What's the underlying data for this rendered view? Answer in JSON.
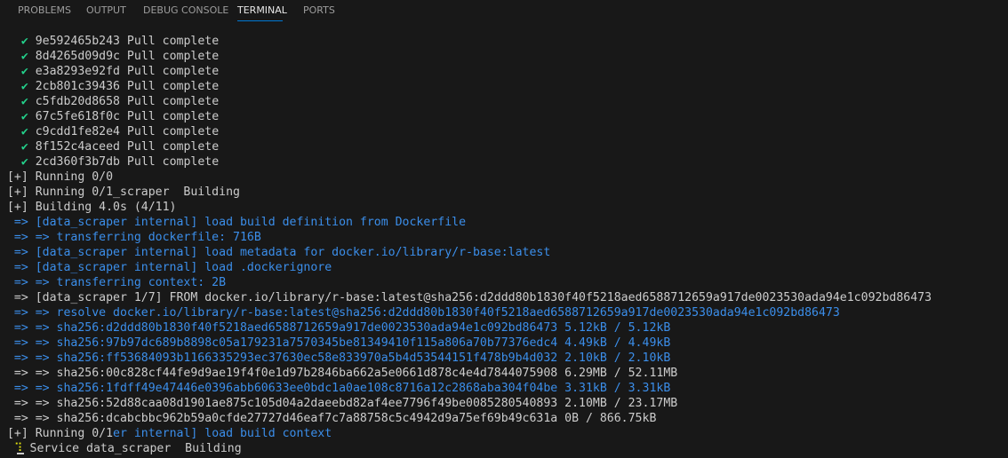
{
  "tabs": [
    {
      "label": "PROBLEMS",
      "active": false
    },
    {
      "label": "OUTPUT",
      "active": false
    },
    {
      "label": "DEBUG CONSOLE",
      "active": false
    },
    {
      "label": "TERMINAL",
      "active": true
    },
    {
      "label": "PORTS",
      "active": false
    }
  ],
  "colors": {
    "background": "#181818",
    "success": "#23d18b",
    "info": "#3b8eea",
    "text": "#cccccc",
    "accent": "#0078d4",
    "spinner": "#e5e510"
  },
  "terminal": {
    "lines": [
      {
        "name": "pull-line",
        "segments": [
          {
            "text": "   ",
            "style": "default"
          },
          {
            "text": "✔",
            "style": "ok",
            "icon": "check-icon"
          },
          {
            "text": " 9e592465b243 Pull complete",
            "style": "default"
          }
        ]
      },
      {
        "name": "pull-line",
        "segments": [
          {
            "text": "   ",
            "style": "default"
          },
          {
            "text": "✔",
            "style": "ok",
            "icon": "check-icon"
          },
          {
            "text": " 8d4265d09d9c Pull complete",
            "style": "default"
          }
        ]
      },
      {
        "name": "pull-line",
        "segments": [
          {
            "text": "   ",
            "style": "default"
          },
          {
            "text": "✔",
            "style": "ok",
            "icon": "check-icon"
          },
          {
            "text": " e3a8293e92fd Pull complete",
            "style": "default"
          }
        ]
      },
      {
        "name": "pull-line",
        "segments": [
          {
            "text": "   ",
            "style": "default"
          },
          {
            "text": "✔",
            "style": "ok",
            "icon": "check-icon"
          },
          {
            "text": " 2cb801c39436 Pull complete",
            "style": "default"
          }
        ]
      },
      {
        "name": "pull-line",
        "segments": [
          {
            "text": "   ",
            "style": "default"
          },
          {
            "text": "✔",
            "style": "ok",
            "icon": "check-icon"
          },
          {
            "text": " c5fdb20d8658 Pull complete",
            "style": "default"
          }
        ]
      },
      {
        "name": "pull-line",
        "segments": [
          {
            "text": "   ",
            "style": "default"
          },
          {
            "text": "✔",
            "style": "ok",
            "icon": "check-icon"
          },
          {
            "text": " 67c5fe618f0c Pull complete",
            "style": "default"
          }
        ]
      },
      {
        "name": "pull-line",
        "segments": [
          {
            "text": "   ",
            "style": "default"
          },
          {
            "text": "✔",
            "style": "ok",
            "icon": "check-icon"
          },
          {
            "text": " c9cdd1fe82e4 Pull complete",
            "style": "default"
          }
        ]
      },
      {
        "name": "pull-line",
        "segments": [
          {
            "text": "   ",
            "style": "default"
          },
          {
            "text": "✔",
            "style": "ok",
            "icon": "check-icon"
          },
          {
            "text": " 8f152c4aceed Pull complete",
            "style": "default"
          }
        ]
      },
      {
        "name": "pull-line",
        "segments": [
          {
            "text": "   ",
            "style": "default"
          },
          {
            "text": "✔",
            "style": "ok",
            "icon": "check-icon"
          },
          {
            "text": " 2cd360f3b7db Pull complete",
            "style": "default"
          }
        ]
      },
      {
        "name": "status-line",
        "segments": [
          {
            "text": " [+] Running 0/0",
            "style": "default"
          }
        ]
      },
      {
        "name": "status-line",
        "segments": [
          {
            "text": " [+] Running 0/1_scraper  Building",
            "style": "default"
          }
        ]
      },
      {
        "name": "status-line",
        "segments": [
          {
            "text": " [+] Building 4.0s (4/11)",
            "style": "default"
          }
        ]
      },
      {
        "name": "build-step-line",
        "segments": [
          {
            "text": "  => [data_scraper internal] load build definition from Dockerfile",
            "style": "blue"
          }
        ]
      },
      {
        "name": "build-step-line",
        "segments": [
          {
            "text": "  => => transferring dockerfile: 716B",
            "style": "blue"
          }
        ]
      },
      {
        "name": "build-step-line",
        "segments": [
          {
            "text": "  => [data_scraper internal] load metadata for docker.io/library/r-base:latest",
            "style": "blue"
          }
        ]
      },
      {
        "name": "build-step-line",
        "segments": [
          {
            "text": "  => [data_scraper internal] load .dockerignore",
            "style": "blue"
          }
        ]
      },
      {
        "name": "build-step-line",
        "segments": [
          {
            "text": "  => => transferring context: 2B",
            "style": "blue"
          }
        ]
      },
      {
        "name": "build-step-line",
        "segments": [
          {
            "text": "  => [data_scraper 1/7] FROM docker.io/library/r-base:latest@sha256:d2ddd80b1830f40f5218aed6588712659a917de0023530ada94e1c092bd86473",
            "style": "default"
          }
        ]
      },
      {
        "name": "build-step-line",
        "segments": [
          {
            "text": "  => => resolve docker.io/library/r-base:latest@sha256:d2ddd80b1830f40f5218aed6588712659a917de0023530ada94e1c092bd86473",
            "style": "blue"
          }
        ]
      },
      {
        "name": "build-step-line",
        "segments": [
          {
            "text": "  => => sha256:d2ddd80b1830f40f5218aed6588712659a917de0023530ada94e1c092bd86473 5.12kB / 5.12kB",
            "style": "blue"
          }
        ]
      },
      {
        "name": "build-step-line",
        "segments": [
          {
            "text": "  => => sha256:97b97dc689b8898c05a179231a7570345be81349410f115a806a70b77376edc4 4.49kB / 4.49kB",
            "style": "blue"
          }
        ]
      },
      {
        "name": "build-step-line",
        "segments": [
          {
            "text": "  => => sha256:ff53684093b1166335293ec37630ec58e833970a5b4d53544151f478b9b4d032 2.10kB / 2.10kB",
            "style": "blue"
          }
        ]
      },
      {
        "name": "build-step-line",
        "segments": [
          {
            "text": "  => => sha256:00c828cf44fe9d9ae19f4f0e1d97b2846ba662a5e0661d878c4e4d7844075908 6.29MB / 52.11MB",
            "style": "default"
          }
        ]
      },
      {
        "name": "build-step-line",
        "segments": [
          {
            "text": "  => => sha256:1fdff49e47446e0396abb60633ee0bdc1a0ae108c8716a12c2868aba304f04be 3.31kB / 3.31kB",
            "style": "blue"
          }
        ]
      },
      {
        "name": "build-step-line",
        "segments": [
          {
            "text": "  => => sha256:52d88caa08d1901ae875c105d04a2daeebd82af4ee7796f49be0085280540893 2.10MB / 23.17MB",
            "style": "default"
          }
        ]
      },
      {
        "name": "build-step-line",
        "segments": [
          {
            "text": "  => => sha256:dcabcbbc962b59a0cfde27727d46eaf7c7a88758c5c4942d9a75ef69b49c631a 0B / 866.75kB",
            "style": "default"
          }
        ]
      },
      {
        "name": "status-line",
        "segments": [
          {
            "text": " [+] Running 0/1",
            "style": "default"
          },
          {
            "text": "er internal] load build context",
            "style": "blue"
          }
        ]
      },
      {
        "name": "service-line",
        "segments": [
          {
            "text": "  ",
            "style": "default"
          },
          {
            "text": "⠹",
            "style": "spinner",
            "icon": "spinner-icon"
          },
          {
            "text": " Service data_scraper  Building",
            "style": "default"
          }
        ]
      }
    ]
  }
}
